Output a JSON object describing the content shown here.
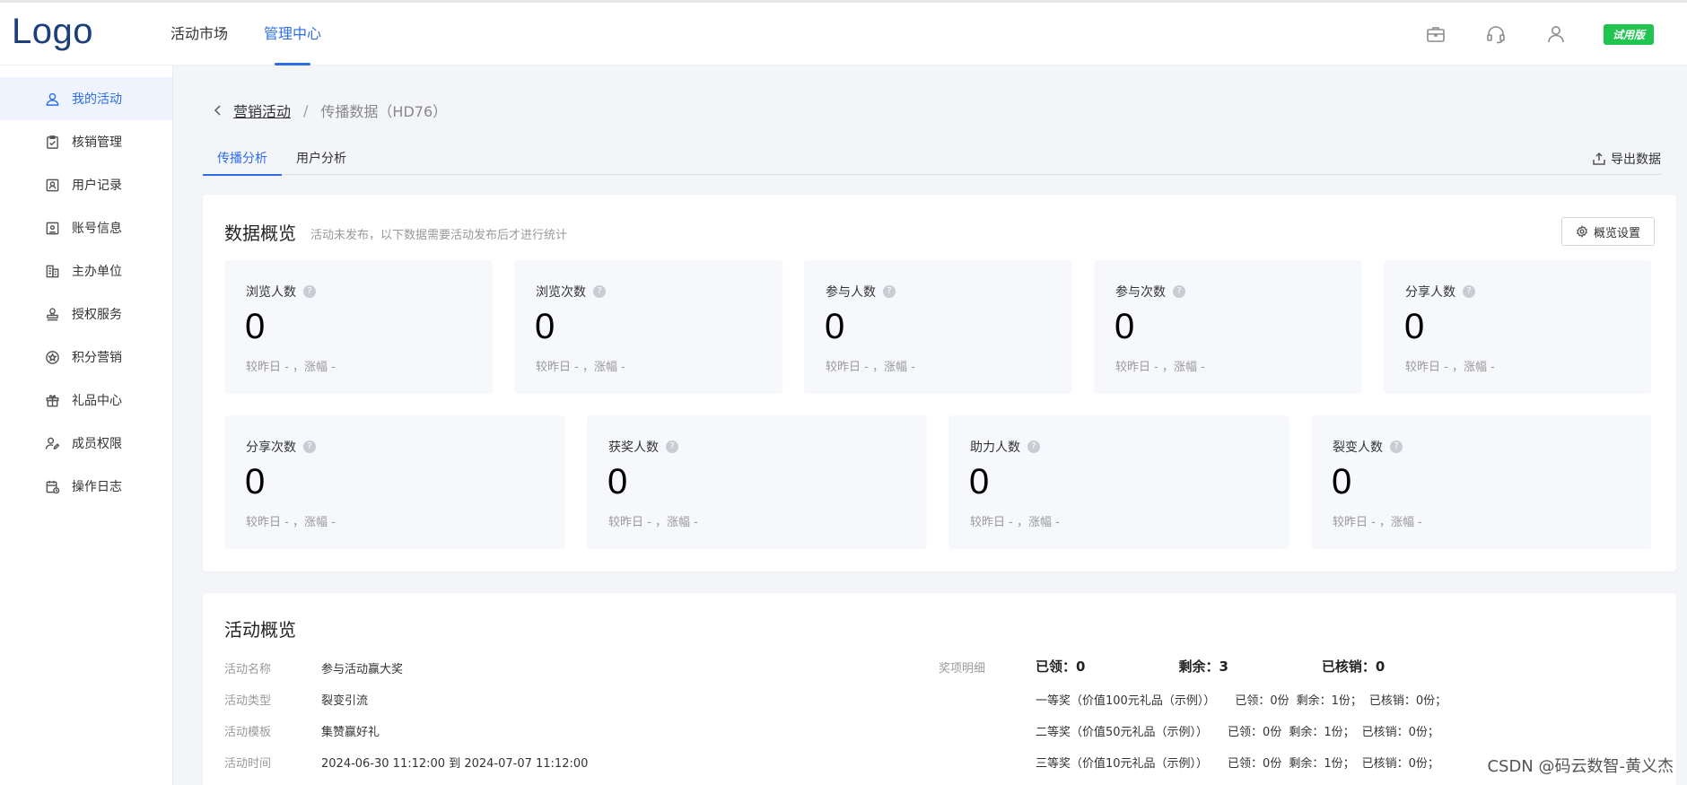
{
  "header": {
    "logo": "Logo",
    "nav": [
      {
        "label": "活动市场",
        "active": false
      },
      {
        "label": "管理中心",
        "active": true
      }
    ],
    "icons": [
      "briefcase-icon",
      "headset-icon",
      "user-icon"
    ],
    "trial_badge": "试用版"
  },
  "sidebar": {
    "items": [
      {
        "label": "我的活动",
        "icon": "user-icon",
        "active": true
      },
      {
        "label": "核销管理",
        "icon": "clipboard-check-icon",
        "active": false
      },
      {
        "label": "用户记录",
        "icon": "contact-card-icon",
        "active": false
      },
      {
        "label": "账号信息",
        "icon": "id-card-icon",
        "active": false
      },
      {
        "label": "主办单位",
        "icon": "building-icon",
        "active": false
      },
      {
        "label": "授权服务",
        "icon": "stamp-icon",
        "active": false
      },
      {
        "label": "积分营销",
        "icon": "star-badge-icon",
        "active": false
      },
      {
        "label": "礼品中心",
        "icon": "gift-icon",
        "active": false
      },
      {
        "label": "成员权限",
        "icon": "user-edit-icon",
        "active": false
      },
      {
        "label": "操作日志",
        "icon": "calendar-log-icon",
        "active": false
      }
    ]
  },
  "breadcrumb": {
    "back": "<",
    "parent": "营销活动",
    "separator": "/",
    "current": "传播数据（HD76）"
  },
  "tabs": [
    {
      "label": "传播分析",
      "active": true
    },
    {
      "label": "用户分析",
      "active": false
    }
  ],
  "export_label": "导出数据",
  "overview": {
    "title": "数据概览",
    "subtitle": "活动未发布，以下数据需要活动发布后才进行统计",
    "settings_label": "概览设置",
    "row1": [
      {
        "label": "浏览人数",
        "value": "0",
        "compare": "较昨日 - ，涨幅 -"
      },
      {
        "label": "浏览次数",
        "value": "0",
        "compare": "较昨日 - ，涨幅 -"
      },
      {
        "label": "参与人数",
        "value": "0",
        "compare": "较昨日 - ，涨幅 -"
      },
      {
        "label": "参与次数",
        "value": "0",
        "compare": "较昨日 - ，涨幅 -"
      },
      {
        "label": "分享人数",
        "value": "0",
        "compare": "较昨日 - ，涨幅 -"
      }
    ],
    "row2": [
      {
        "label": "分享次数",
        "value": "0",
        "compare": "较昨日 - ，涨幅 -"
      },
      {
        "label": "获奖人数",
        "value": "0",
        "compare": "较昨日 - ，涨幅 -"
      },
      {
        "label": "助力人数",
        "value": "0",
        "compare": "较昨日 - ，涨幅 -"
      },
      {
        "label": "裂变人数",
        "value": "0",
        "compare": "较昨日 - ，涨幅 -"
      }
    ]
  },
  "activity": {
    "title": "活动概览",
    "info": [
      {
        "key": "活动名称",
        "value": "参与活动赢大奖"
      },
      {
        "key": "活动类型",
        "value": "裂变引流"
      },
      {
        "key": "活动模板",
        "value": "集赞赢好礼"
      },
      {
        "key": "活动时间",
        "value": "2024-06-30 11:12:00 到 2024-07-07 11:12:00"
      }
    ],
    "prize_head": "奖项明细",
    "summary": {
      "claimed": "已领：0",
      "remaining": "剩余：3",
      "redeemed": "已核销：0"
    },
    "prizes": [
      {
        "name": "一等奖（价值100元礼品（示例））",
        "claimed": "已领：0份",
        "remaining": "剩余：1份；",
        "redeemed": "已核销：0份；"
      },
      {
        "name": "二等奖（价值50元礼品（示例））",
        "claimed": "已领：0份",
        "remaining": "剩余：1份；",
        "redeemed": "已核销：0份；"
      },
      {
        "name": "三等奖（价值10元礼品（示例））",
        "claimed": "已领：0份",
        "remaining": "剩余：1份；",
        "redeemed": "已核销：0份；"
      }
    ]
  },
  "watermark": "CSDN @码云数智-黄义杰",
  "colors": {
    "accent": "#2d6de6",
    "trial": "#1fc54f",
    "page_bg": "#f3f5f9",
    "metric_bg": "#f6f8fc"
  }
}
